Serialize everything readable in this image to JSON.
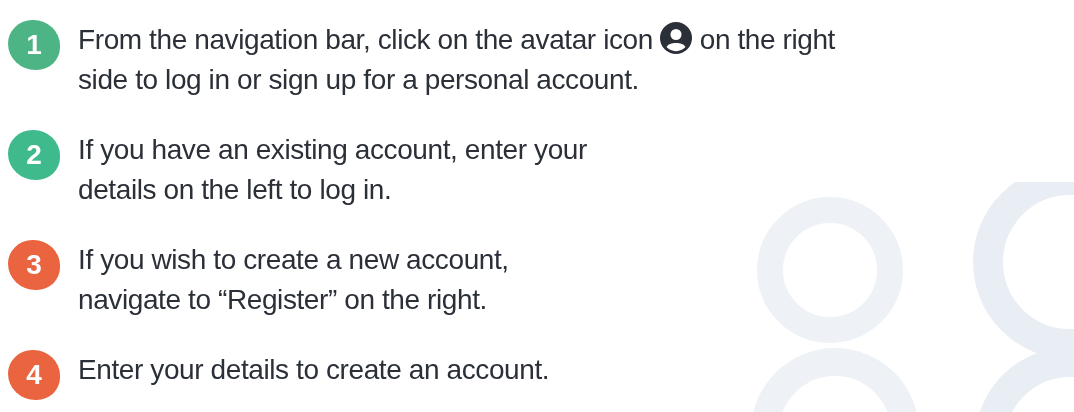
{
  "steps": [
    {
      "number": "1",
      "color": "#4db585",
      "kind": "icon_inline",
      "text": "From the navigation bar, click on the avatar icon",
      "text_after": "on the right\nside to log in or sign up for a personal account."
    },
    {
      "number": "2",
      "color": "#3fba8c",
      "kind": "plain",
      "text": "If you have an existing account, enter your\ndetails on the left to log in."
    },
    {
      "number": "3",
      "color": "#e9643f",
      "kind": "plain",
      "text": "If you wish to create a new account,\nnavigate to “Register” on the right."
    },
    {
      "number": "4",
      "color": "#e9643f",
      "kind": "plain",
      "text": "Enter your details to create an account."
    }
  ]
}
